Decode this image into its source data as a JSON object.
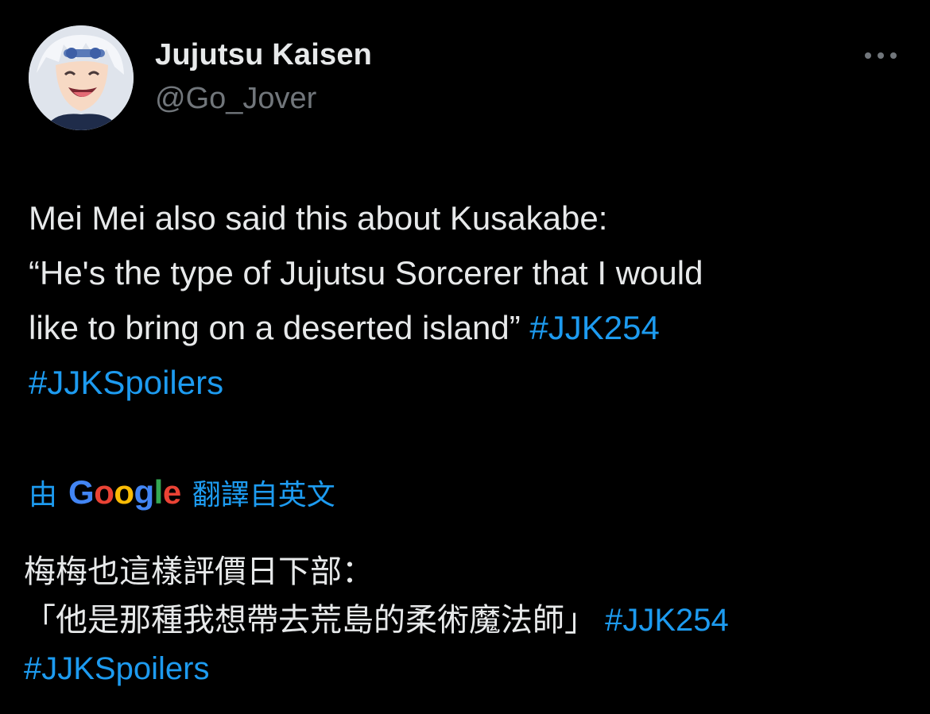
{
  "author": {
    "display_name": "Jujutsu Kaisen",
    "handle": "@Go_Jover"
  },
  "tweet": {
    "line1": "Mei Mei also said this about Kusakabe:",
    "line2": "“He's the type of Jujutsu Sorcerer that I would",
    "line3_text": "like to bring on a deserted island” ",
    "hashtag1": "#JJK254",
    "hashtag2": "#JJKSpoilers"
  },
  "translation_label": {
    "prefix": "由",
    "google_letters": [
      "G",
      "o",
      "o",
      "g",
      "l",
      "e"
    ],
    "suffix": "翻譯自英文"
  },
  "translated": {
    "line1": "梅梅也這樣評價日下部：",
    "line2_text": "「他是那種我想帶去荒島的柔術魔法師」 ",
    "hashtag1": "#JJK254",
    "hashtag2": "#JJKSpoilers"
  },
  "icons": {
    "more": "more-horizontal-icon"
  },
  "colors": {
    "background": "#000000",
    "text_primary": "#e7e9ea",
    "text_secondary": "#71767b",
    "link": "#1d9bf0",
    "google_blue": "#4285f4",
    "google_red": "#ea4335",
    "google_yellow": "#fbbc05",
    "google_green": "#34a853"
  }
}
